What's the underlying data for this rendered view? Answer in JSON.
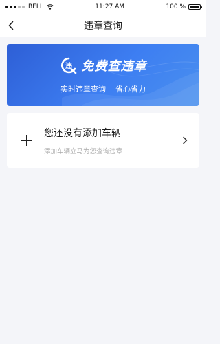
{
  "status_bar": {
    "carrier": "BELL",
    "time": "11:27 AM",
    "battery_text": "100 %",
    "battery_level": 1.0
  },
  "nav": {
    "title": "违章查询",
    "back_icon": "chevron-left-icon"
  },
  "banner": {
    "title": "免费查违章",
    "subtitle_left": "实时违章查询",
    "subtitle_right": "省心省力",
    "logo_icon": "violation-logo-icon",
    "gradient_start": "#2e5fd6",
    "gradient_end": "#4a90ee"
  },
  "empty_card": {
    "title": "您还没有添加车辆",
    "description": "添加车辆立马为您查询违章",
    "plus_icon": "plus-icon",
    "chevron_icon": "chevron-right-icon"
  },
  "colors": {
    "background": "#f4f5f9",
    "card_background": "#ffffff",
    "muted_text": "#aaaaaa"
  }
}
